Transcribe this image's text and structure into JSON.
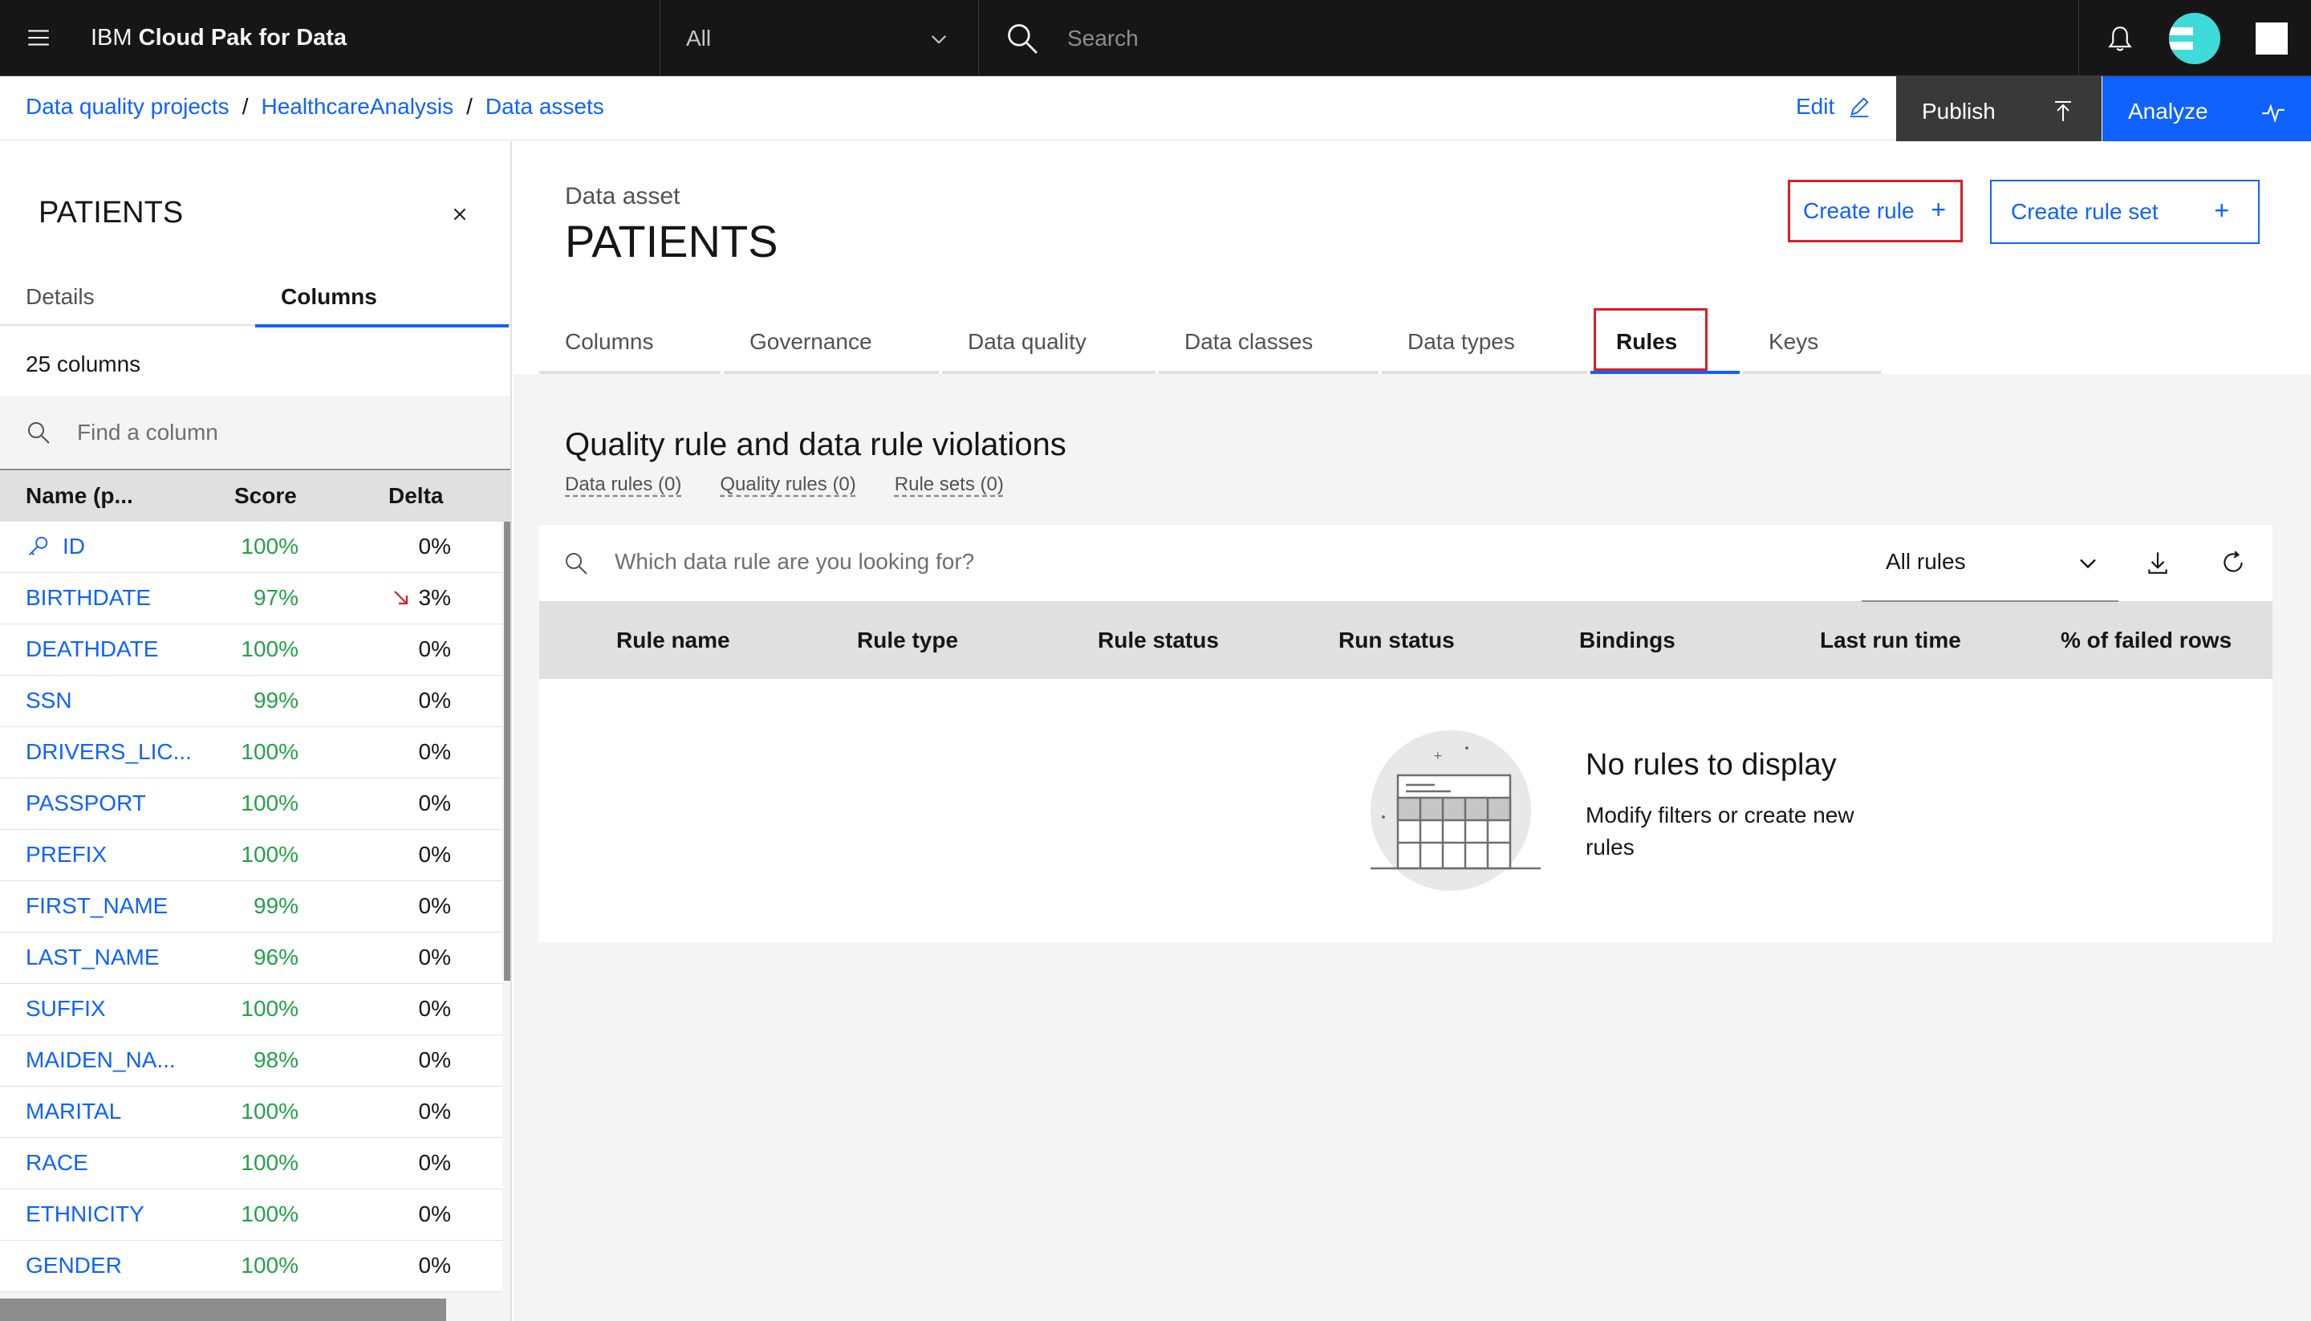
{
  "header": {
    "brand_prefix": "IBM",
    "brand_name": "Cloud Pak for Data",
    "scope_value": "All",
    "search_placeholder": "Search"
  },
  "breadcrumb": {
    "items": [
      "Data quality projects",
      "HealthcareAnalysis",
      "Data assets"
    ],
    "separator": "/"
  },
  "actions": {
    "edit_label": "Edit",
    "publish_label": "Publish",
    "analyze_label": "Analyze"
  },
  "left_panel": {
    "title": "PATIENTS",
    "tabs": [
      "Details",
      "Columns"
    ],
    "active_tab": "Columns",
    "column_count": "25 columns",
    "search_placeholder": "Find a column",
    "headers": {
      "name": "Name (p...",
      "score": "Score",
      "delta": "Delta"
    },
    "rows": [
      {
        "name": "ID",
        "score": "100%",
        "delta": "0%",
        "key": true,
        "trend": ""
      },
      {
        "name": "BIRTHDATE",
        "score": "97%",
        "delta": "3%",
        "key": false,
        "trend": "down"
      },
      {
        "name": "DEATHDATE",
        "score": "100%",
        "delta": "0%",
        "key": false,
        "trend": ""
      },
      {
        "name": "SSN",
        "score": "99%",
        "delta": "0%",
        "key": false,
        "trend": ""
      },
      {
        "name": "DRIVERS_LIC...",
        "score": "100%",
        "delta": "0%",
        "key": false,
        "trend": ""
      },
      {
        "name": "PASSPORT",
        "score": "100%",
        "delta": "0%",
        "key": false,
        "trend": ""
      },
      {
        "name": "PREFIX",
        "score": "100%",
        "delta": "0%",
        "key": false,
        "trend": ""
      },
      {
        "name": "FIRST_NAME",
        "score": "99%",
        "delta": "0%",
        "key": false,
        "trend": ""
      },
      {
        "name": "LAST_NAME",
        "score": "96%",
        "delta": "0%",
        "key": false,
        "trend": ""
      },
      {
        "name": "SUFFIX",
        "score": "100%",
        "delta": "0%",
        "key": false,
        "trend": ""
      },
      {
        "name": "MAIDEN_NA...",
        "score": "98%",
        "delta": "0%",
        "key": false,
        "trend": ""
      },
      {
        "name": "MARITAL",
        "score": "100%",
        "delta": "0%",
        "key": false,
        "trend": ""
      },
      {
        "name": "RACE",
        "score": "100%",
        "delta": "0%",
        "key": false,
        "trend": ""
      },
      {
        "name": "ETHNICITY",
        "score": "100%",
        "delta": "0%",
        "key": false,
        "trend": ""
      },
      {
        "name": "GENDER",
        "score": "100%",
        "delta": "0%",
        "key": false,
        "trend": ""
      }
    ]
  },
  "main": {
    "asset_label": "Data asset",
    "asset_title": "PATIENTS",
    "create_rule_label": "Create rule",
    "create_rule_set_label": "Create rule set",
    "tabs": [
      "Columns",
      "Governance",
      "Data quality",
      "Data classes",
      "Data types",
      "Rules",
      "Keys"
    ],
    "active_tab": "Rules",
    "violations_title": "Quality rule and data rule violations",
    "violation_links": [
      "Data rules (0)",
      "Quality rules (0)",
      "Rule sets (0)"
    ],
    "rule_search_placeholder": "Which data rule are you looking for?",
    "filter_value": "All rules",
    "table_headers": [
      "Rule name",
      "Rule type",
      "Rule status",
      "Run status",
      "Bindings",
      "Last run time",
      "% of failed rows"
    ],
    "empty_title": "No rules to display",
    "empty_subtitle": "Modify filters or create new rules"
  },
  "colors": {
    "accent": "#0f62fe",
    "highlight_border": "#da1e28",
    "score_green": "#24a148",
    "header_bg": "#161616"
  }
}
